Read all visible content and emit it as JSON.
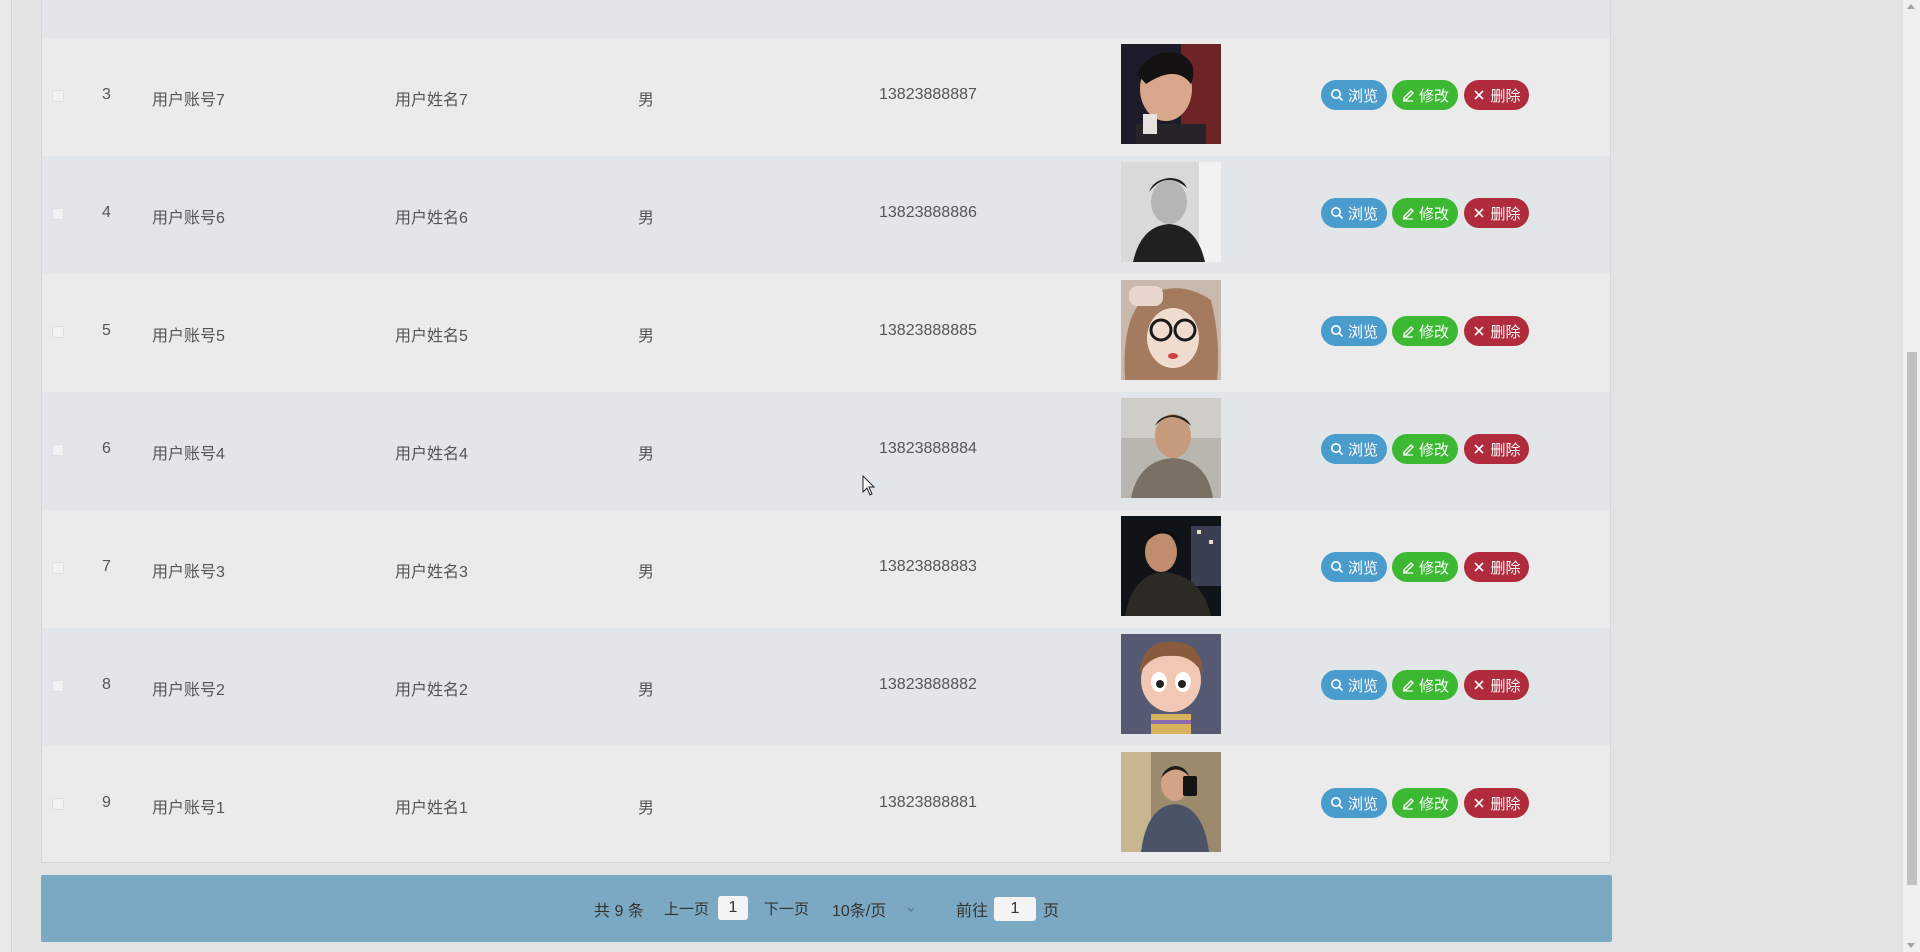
{
  "table": {
    "rows": [
      {
        "index": "3",
        "account": "用户账号7",
        "name": "用户姓名7",
        "gender": "男",
        "phone": "13823888887"
      },
      {
        "index": "4",
        "account": "用户账号6",
        "name": "用户姓名6",
        "gender": "男",
        "phone": "13823888886"
      },
      {
        "index": "5",
        "account": "用户账号5",
        "name": "用户姓名5",
        "gender": "男",
        "phone": "13823888885"
      },
      {
        "index": "6",
        "account": "用户账号4",
        "name": "用户姓名4",
        "gender": "男",
        "phone": "13823888884"
      },
      {
        "index": "7",
        "account": "用户账号3",
        "name": "用户姓名3",
        "gender": "男",
        "phone": "13823888883"
      },
      {
        "index": "8",
        "account": "用户账号2",
        "name": "用户姓名2",
        "gender": "男",
        "phone": "13823888882"
      },
      {
        "index": "9",
        "account": "用户账号1",
        "name": "用户姓名1",
        "gender": "男",
        "phone": "13823888881"
      }
    ],
    "actions": {
      "view_label": "浏览",
      "edit_label": "修改",
      "delete_label": "删除"
    }
  },
  "pagination": {
    "total": "共 9 条",
    "prev": "上一页",
    "current_page": "1",
    "next": "下一页",
    "page_size": "10条/页",
    "goto_label": "前往",
    "goto_value": "1",
    "page_suffix": "页"
  },
  "colors": {
    "view_button": "#4a9ccd",
    "edit_button": "#3cb833",
    "delete_button": "#b02b3c",
    "pager_background": "#7ba9c3"
  }
}
